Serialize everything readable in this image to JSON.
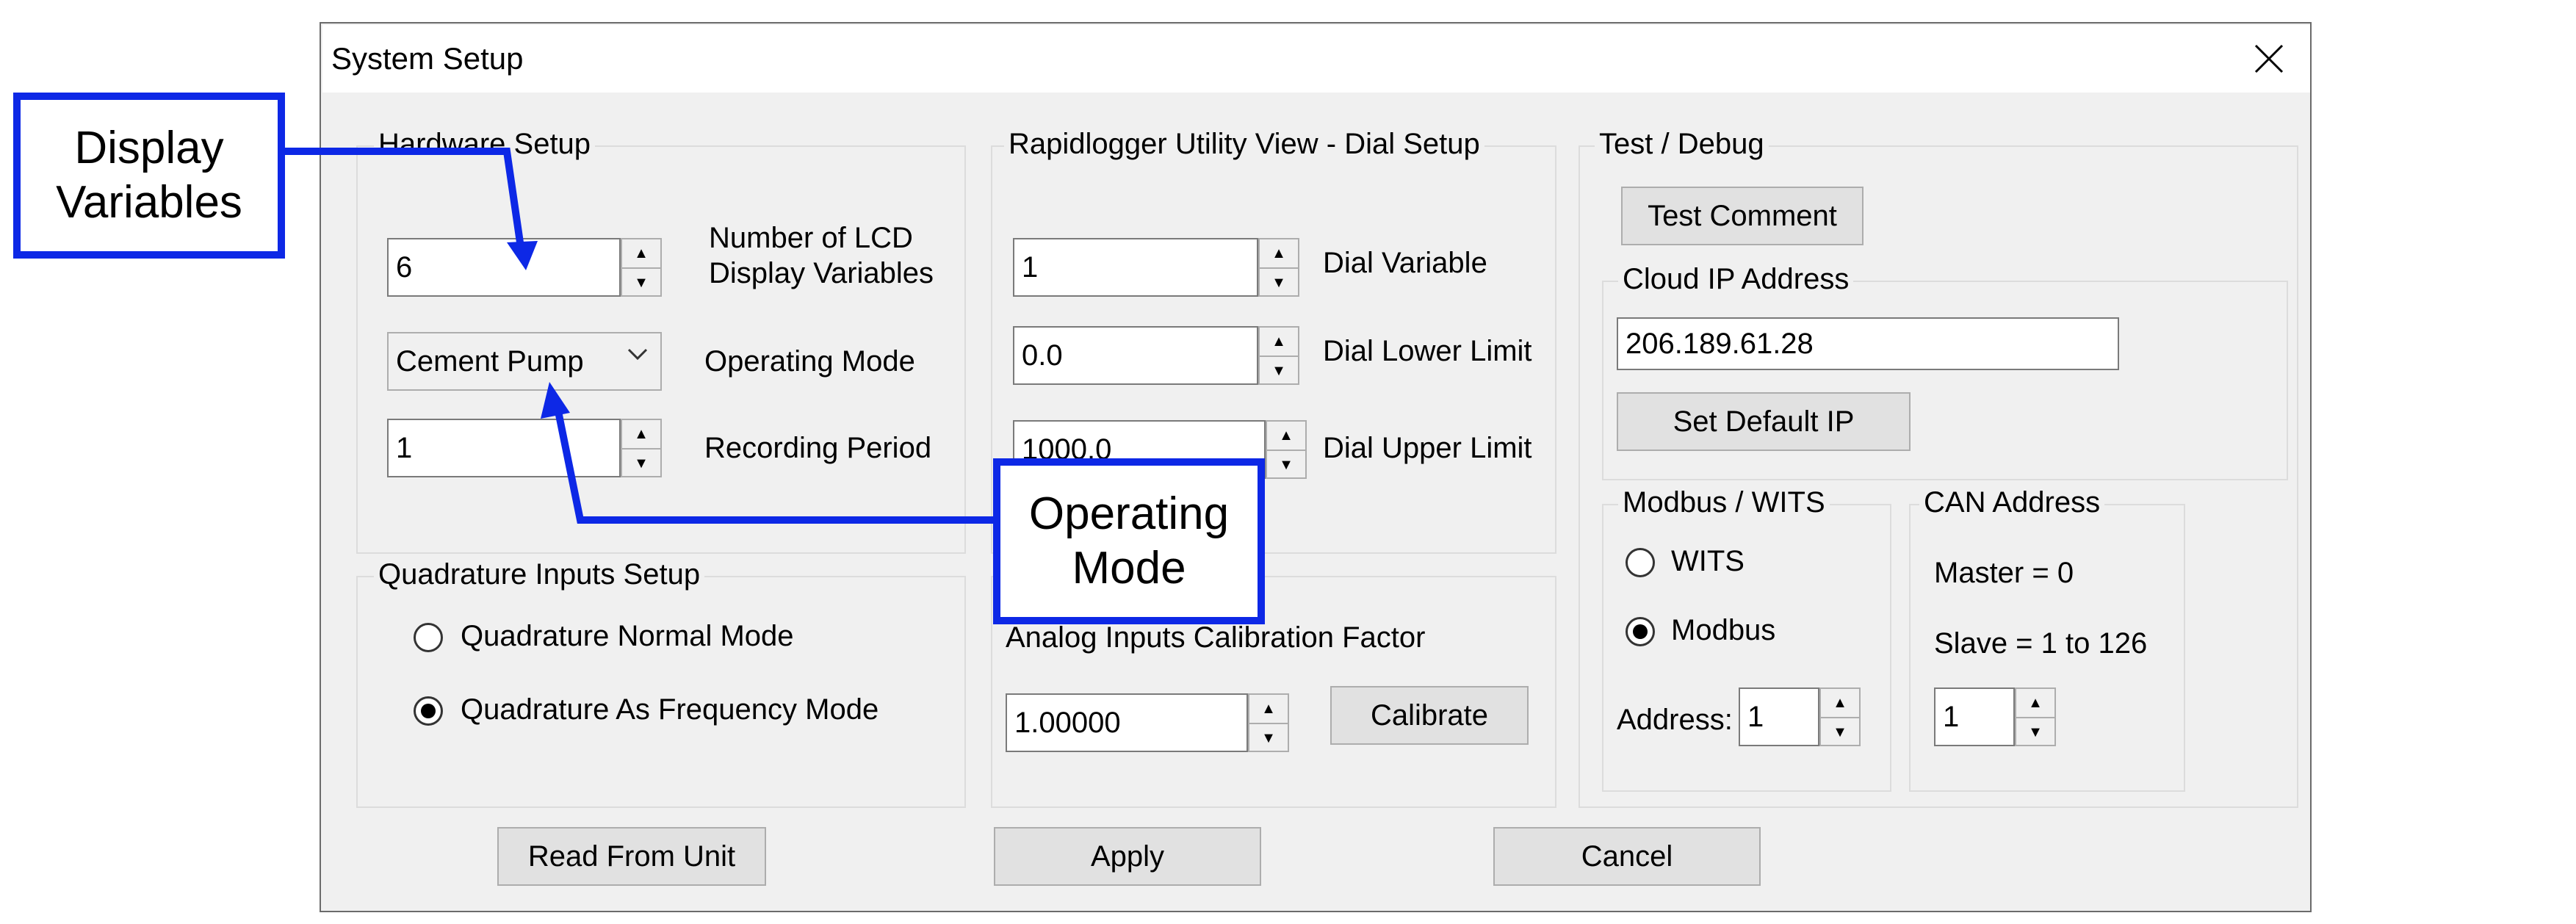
{
  "dialog": {
    "title": "System Setup",
    "close_icon": "close-icon"
  },
  "hardware": {
    "legend": "Hardware Setup",
    "lcd_vars_value": "6",
    "lcd_vars_label_1": "Number of LCD",
    "lcd_vars_label_2": "Display Variables",
    "operating_mode_value": "Cement Pump",
    "operating_mode_label": "Operating Mode",
    "recording_period_value": "1",
    "recording_period_label": "Recording Period"
  },
  "dial": {
    "legend": "Rapidlogger Utility View - Dial Setup",
    "variable_value": "1",
    "variable_label": "Dial Variable",
    "lower_value": "0.0",
    "lower_label": "Dial Lower Limit",
    "upper_value": "1000.0",
    "upper_label": "Dial Upper Limit"
  },
  "test": {
    "legend": "Test / Debug",
    "test_comment_label": "Test Comment"
  },
  "cloud": {
    "legend": "Cloud IP Address",
    "ip_value": "206.189.61.28",
    "set_default_label": "Set Default IP"
  },
  "modbus": {
    "legend": "Modbus / WITS",
    "wits_label": "WITS",
    "modbus_label": "Modbus",
    "selected": "Modbus",
    "address_label": "Address:",
    "address_value": "1"
  },
  "can": {
    "legend": "CAN Address",
    "master_text": "Master = 0",
    "slave_text": "Slave = 1 to 126",
    "address_value": "1"
  },
  "quadrature": {
    "legend": "Quadrature Inputs Setup",
    "normal_label": "Quadrature Normal Mode",
    "frequency_label": "Quadrature As Frequency Mode",
    "selected": "Quadrature As Frequency Mode"
  },
  "analog": {
    "label": "Analog Inputs Calibration Factor",
    "value": "1.00000",
    "calibrate_label": "Calibrate"
  },
  "footer": {
    "read_label": "Read From Unit",
    "apply_label": "Apply",
    "cancel_label": "Cancel"
  },
  "annotations": {
    "display_variables_1": "Display",
    "display_variables_2": "Variables",
    "operating_mode_1": "Operating",
    "operating_mode_2": "Mode",
    "color": "#0d28e6"
  },
  "colors": {
    "dialog_bg": "#f0f0f0",
    "titlebar_bg": "#ffffff",
    "button_bg": "#e1e1e1",
    "callout_border": "#0d28e6"
  }
}
